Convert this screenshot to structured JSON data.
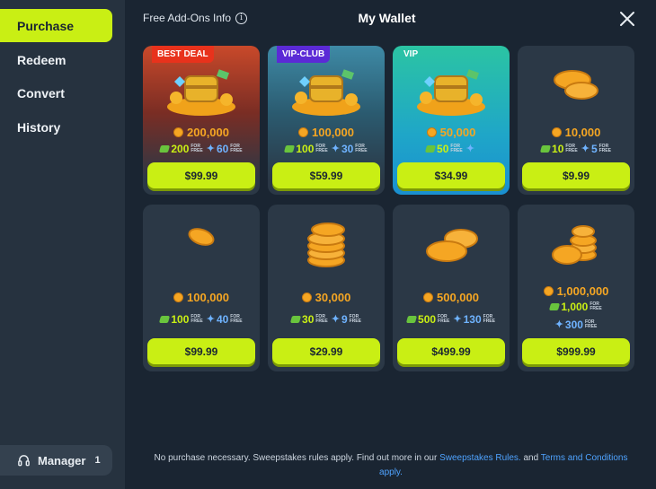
{
  "sidebar": {
    "items": [
      {
        "label": "Purchase"
      },
      {
        "label": "Redeem"
      },
      {
        "label": "Convert"
      },
      {
        "label": "History"
      }
    ],
    "manager": {
      "label": "Manager",
      "count": "1"
    }
  },
  "header": {
    "addons_link": "Free Add-Ons Info",
    "title": "My Wallet"
  },
  "free_label_top": "FOR",
  "free_label_bottom": "FREE",
  "packages": [
    {
      "badge": "BEST DEAL",
      "coins": "200,000",
      "gold": "200",
      "sweeps": "60",
      "price": "$99.99"
    },
    {
      "badge": "VIP-CLUB",
      "coins": "100,000",
      "gold": "100",
      "sweeps": "30",
      "price": "$59.99"
    },
    {
      "badge": "VIP",
      "coins": "50,000",
      "gold": "50",
      "sweeps": "",
      "price": "$34.99"
    },
    {
      "badge": "",
      "coins": "10,000",
      "gold": "10",
      "sweeps": "5",
      "price": "$9.99"
    },
    {
      "badge": "",
      "coins": "100,000",
      "gold": "100",
      "sweeps": "40",
      "price": "$99.99"
    },
    {
      "badge": "",
      "coins": "30,000",
      "gold": "30",
      "sweeps": "9",
      "price": "$29.99"
    },
    {
      "badge": "",
      "coins": "500,000",
      "gold": "500",
      "sweeps": "130",
      "price": "$499.99"
    },
    {
      "badge": "",
      "coins": "1,000,000",
      "gold": "1,000",
      "sweeps": "300",
      "price": "$999.99"
    }
  ],
  "footer": {
    "text_before": "No purchase necessary. Sweepstakes rules apply. Find out more in our ",
    "link1": "Sweepstakes Rules.",
    "text_middle": " and ",
    "link2": "Terms and Conditions",
    "text_after": "apply."
  },
  "colors": {
    "accent": "#c9ef14",
    "coin": "#f5a623",
    "link": "#4fa3ff",
    "background": "#1a2532",
    "sidebar": "#26323f"
  }
}
